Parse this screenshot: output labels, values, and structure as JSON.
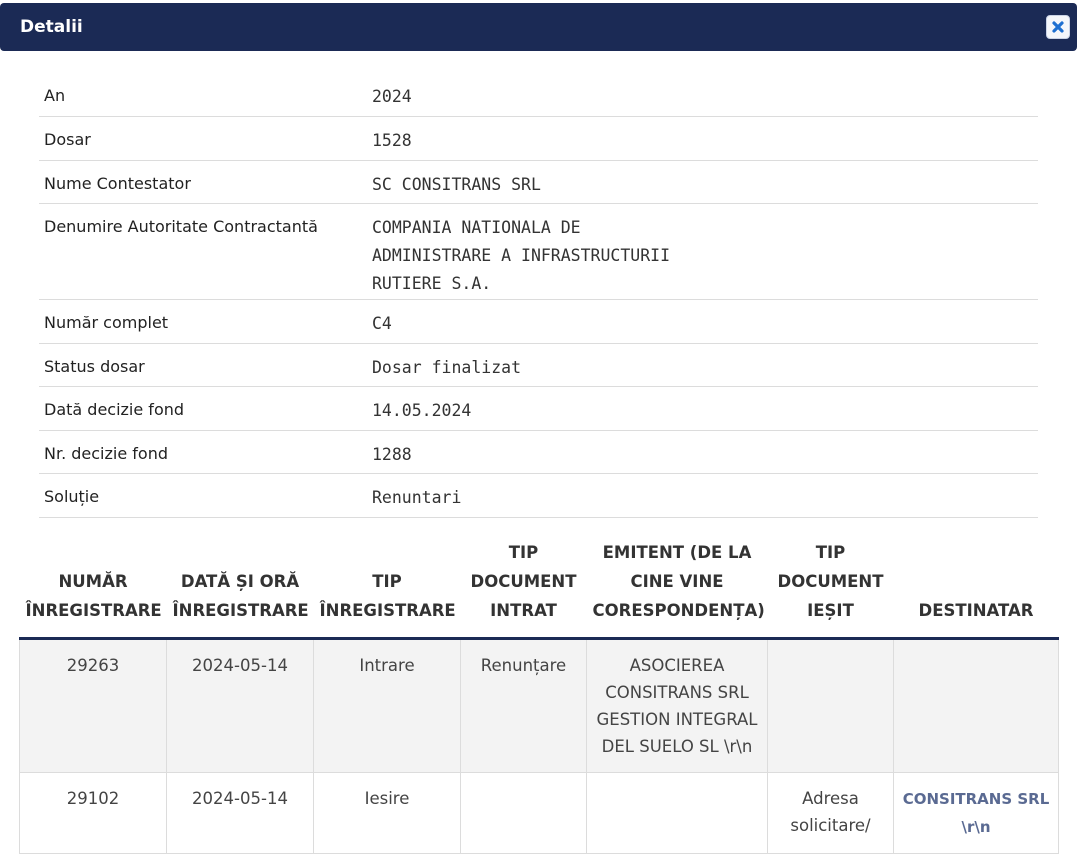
{
  "dialog": {
    "title": "Detalii",
    "close_icon": "close-icon"
  },
  "details": [
    {
      "label": "An",
      "value": "2024"
    },
    {
      "label": "Dosar",
      "value": "1528"
    },
    {
      "label": "Nume Contestator",
      "value": "SC CONSITRANS SRL"
    },
    {
      "label": "Denumire Autoritate Contractantă",
      "value": "COMPANIA NATIONALA DE\nADMINISTRARE A INFRASTRUCTURII\nRUTIERE S.A."
    },
    {
      "label": "Număr complet",
      "value": "C4"
    },
    {
      "label": "Status dosar",
      "value": "Dosar finalizat"
    },
    {
      "label": "Dată decizie fond",
      "value": "14.05.2024"
    },
    {
      "label": "Nr. decizie fond",
      "value": "1288"
    },
    {
      "label": "Soluție",
      "value": "Renuntari"
    }
  ],
  "registry": {
    "headers": [
      "NUMĂR ÎNREGISTRARE",
      "DATĂ ȘI ORĂ ÎNREGISTRARE",
      "TIP ÎNREGISTRARE",
      "TIP DOCUMENT INTRAT",
      "EMITENT (DE LA CINE VINE CORESPONDENȚA)",
      "TIP DOCUMENT IEȘIT",
      "DESTINATAR"
    ],
    "rows": [
      [
        "29263",
        "2024-05-14",
        "Intrare",
        "Renunțare",
        "ASOCIEREA CONSITRANS SRL GESTION INTEGRAL DEL SUELO SL \\r\\n",
        "",
        ""
      ],
      [
        "29102",
        "2024-05-14",
        "Iesire",
        "",
        "",
        "Adresa solicitare/",
        "CONSITRANS SRL \\r\\n"
      ]
    ]
  }
}
